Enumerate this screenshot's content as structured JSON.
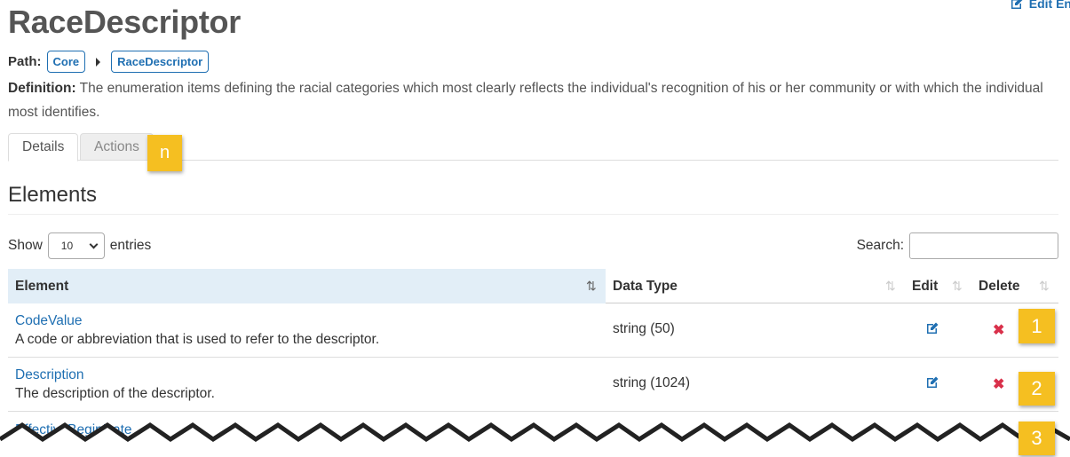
{
  "header": {
    "edit_entity_label": "Edit En",
    "title": "RaceDescriptor"
  },
  "path": {
    "label": "Path:",
    "crumbs": [
      "Core",
      "RaceDescriptor"
    ]
  },
  "definition": {
    "label": "Definition:",
    "text": "The enumeration items defining the racial categories which most clearly reflects the individual's recognition of his or her community or with which the individual most identifies."
  },
  "tabs": [
    {
      "label": "Details",
      "active": true
    },
    {
      "label": "Actions",
      "active": false
    }
  ],
  "badges": {
    "actions": "n",
    "row1": "1",
    "row2": "2",
    "row3": "3"
  },
  "section": {
    "title": "Elements"
  },
  "controls": {
    "show_label": "Show",
    "entries_value": "10",
    "entries_label": "entries",
    "search_label": "Search:"
  },
  "table": {
    "columns": [
      "Element",
      "Data Type",
      "Edit",
      "Delete"
    ],
    "rows": [
      {
        "name": "CodeValue",
        "description": "A code or abbreviation that is used to refer to the descriptor.",
        "type": "string (50)"
      },
      {
        "name": "Description",
        "description": "The description of the descriptor.",
        "type": "string (1024)"
      },
      {
        "name": "EffectiveBeginDate",
        "description": "",
        "type": ""
      }
    ]
  },
  "colors": {
    "link": "#1f6fb2",
    "badge": "#f5bf21",
    "delete": "#d9304a",
    "header_sorted": "#e2eef7"
  },
  "icons": {
    "edit": "pencil-square-icon",
    "delete": "x-icon",
    "sort": "sort-icon"
  }
}
